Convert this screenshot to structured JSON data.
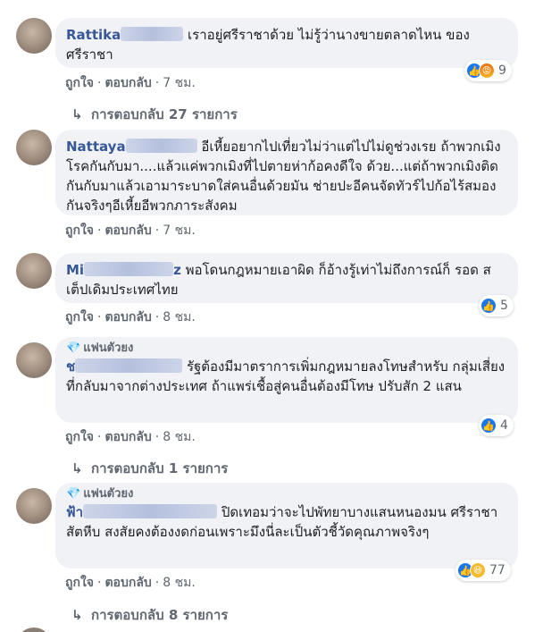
{
  "comments": [
    {
      "author_visible": "Rattika",
      "text": "เราอยู่ศรีราชาด้วย ไม่รู้ว่านางขายตลาดไหน ของศรีราชา",
      "like_label": "ถูกใจ",
      "reply_label": "ตอบกลับ",
      "time": "7 ชม.",
      "reaction_icons": [
        "like-icon",
        "angry-icon"
      ],
      "reaction_count": "9",
      "replies_label": "การตอบกลับ 27 รายการ"
    },
    {
      "author_visible": "Nattaya",
      "text": "อีเหี้ยอยากไปเที่ยวไม่ว่าแต่ไปไม่ดูช่วงเรย ถ้าพวกเมิงโรคกันกับมา....แล้วแค่พวกเมิงที่ไปตายห่าก้อคงดีใจ ด้วย...แต่ถ้าพวกเมิงติดกันกับมาแล้วเอามาระบาดใส่คนอื่นด้วยมัน ช่ายปะอีคนจัดทัวร์ไปก้อไร้สมองกันจริงๆอีเหี้ยอีพวกภาระสังคม",
      "like_label": "ถูกใจ",
      "reply_label": "ตอบกลับ",
      "time": "7 ชม."
    },
    {
      "author_visible": "Mi",
      "author_suffix": "z",
      "text": "พอโดนกฎหมายเอาผิด ก็อ้างรู้เท่าไม่ถึงการณ์ก็ รอด สเต็ปเดิมประเทศไทย",
      "like_label": "ถูกใจ",
      "reply_label": "ตอบกลับ",
      "time": "8 ชม.",
      "reaction_icons": [
        "like-icon"
      ],
      "reaction_count": "5"
    },
    {
      "badge": "แฟนตัวยง",
      "author_visible": "ช",
      "text": "รัฐต้องมีมาตราการเพิ่มกฎหมายลงโทษสำหรับ กลุ่มเสี่ยงที่กลับมาจากต่างประเทศ ถ้าแพร่เชื้อสู่คนอื่นต้องมีโทษ ปรับสัก 2 แสน",
      "like_label": "ถูกใจ",
      "reply_label": "ตอบกลับ",
      "time": "8 ชม.",
      "reaction_icons": [
        "like-icon"
      ],
      "reaction_count": "4",
      "replies_label": "การตอบกลับ 1 รายการ"
    },
    {
      "badge": "แฟนตัวยง",
      "author_visible": "ฟ้า",
      "text": "ปิดเทอมว่าจะไปพัทยาบางแสนหนองมน ศรีราชาสัตหีบ สงสัยคงต้องงดก่อนเพราะมึงนี่ละเป็นตัวชี้วัดคุณภาพจริงๆ",
      "like_label": "ถูกใจ",
      "reply_label": "ตอบกลับ",
      "time": "8 ชม.",
      "reaction_icons": [
        "like-icon",
        "haha-icon"
      ],
      "reaction_count": "77",
      "replies_label": "การตอบกลับ 8 รายการ"
    }
  ],
  "colors": {
    "author": "#385898",
    "bubble": "#f0f2f5",
    "meta": "#606770",
    "like": "#1877f2"
  }
}
